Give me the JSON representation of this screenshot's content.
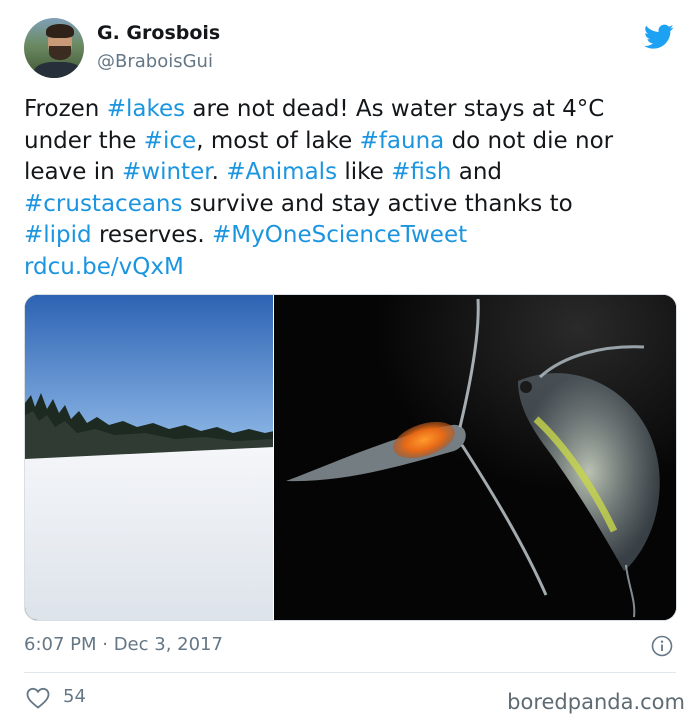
{
  "author": {
    "name": "G. Grosbois",
    "handle": "@BraboisGui"
  },
  "tweet": {
    "lines": [
      [
        {
          "t": "Frozen "
        },
        {
          "t": "#lakes",
          "kind": "hashtag"
        },
        {
          "t": " are not dead! As water stays at 4°C"
        }
      ],
      [
        {
          "t": "under the "
        },
        {
          "t": "#ice",
          "kind": "hashtag"
        },
        {
          "t": ", most of lake "
        },
        {
          "t": "#fauna",
          "kind": "hashtag"
        },
        {
          "t": " do not die nor"
        }
      ],
      [
        {
          "t": "leave in "
        },
        {
          "t": "#winter",
          "kind": "hashtag"
        },
        {
          "t": ". "
        },
        {
          "t": "#Animals",
          "kind": "hashtag"
        },
        {
          "t": " like "
        },
        {
          "t": "#fish",
          "kind": "hashtag"
        },
        {
          "t": " and"
        }
      ],
      [
        {
          "t": "#crustaceans",
          "kind": "hashtag"
        },
        {
          "t": " survive and stay active thanks to"
        }
      ],
      [
        {
          "t": "#lipid",
          "kind": "hashtag"
        },
        {
          "t": " reserves. "
        },
        {
          "t": "#MyOneScienceTweet",
          "kind": "hashtag"
        }
      ],
      [
        {
          "t": "rdcu.be/vQxM",
          "kind": "link"
        }
      ]
    ]
  },
  "timestamp": "6:07 PM · Dec 3, 2017",
  "likes": "54",
  "watermark": "boredpanda.com",
  "colors": {
    "link": "#1b95e0",
    "secondary_text": "#657786",
    "twitter_blue": "#1da1f2"
  },
  "icons": {
    "brand": "twitter-bird-icon",
    "info": "info-icon",
    "like": "heart-icon"
  }
}
